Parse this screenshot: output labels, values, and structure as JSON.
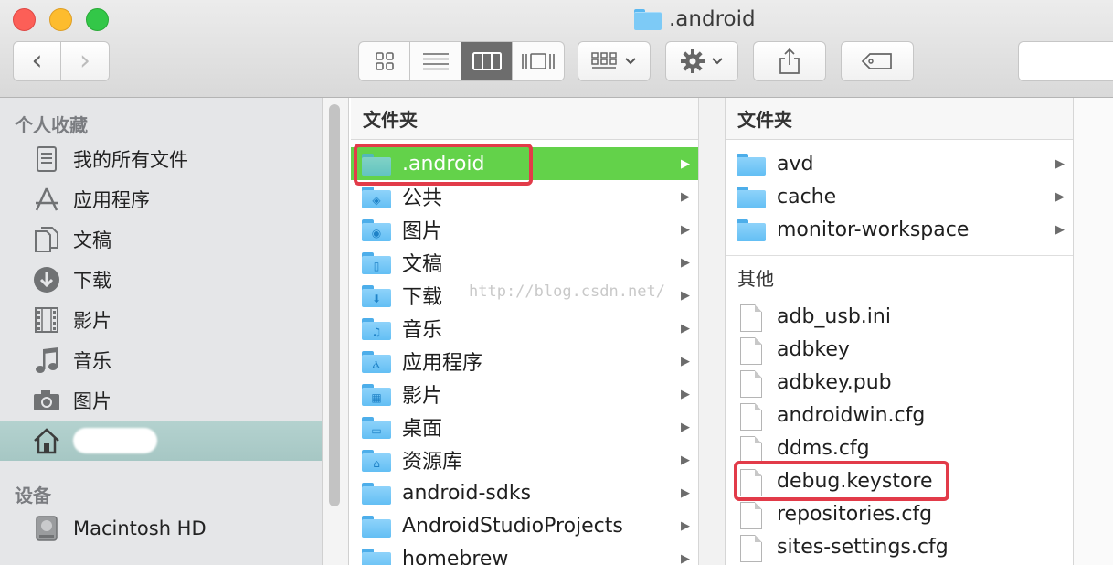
{
  "window": {
    "title": ".android"
  },
  "toolbar": {
    "back_glyph": "‹",
    "forward_glyph": "›",
    "view_modes": [
      "icon-view",
      "list-view",
      "column-view",
      "coverflow-view"
    ],
    "active_view": "column-view"
  },
  "sidebar": {
    "favorites_header": "个人收藏",
    "favorites": [
      {
        "label": "我的所有文件",
        "icon": "all-files-icon"
      },
      {
        "label": "应用程序",
        "icon": "applications-icon"
      },
      {
        "label": "文稿",
        "icon": "documents-icon"
      },
      {
        "label": "下载",
        "icon": "downloads-icon"
      },
      {
        "label": "影片",
        "icon": "movies-icon"
      },
      {
        "label": "音乐",
        "icon": "music-icon"
      },
      {
        "label": "图片",
        "icon": "pictures-icon"
      },
      {
        "label": "",
        "icon": "home-icon",
        "selected": true
      }
    ],
    "devices_header": "设备",
    "devices": [
      {
        "label": "Macintosh HD",
        "icon": "hard-drive-icon"
      }
    ]
  },
  "column1": {
    "header": "文件夹",
    "items": [
      {
        "label": ".android",
        "icon": "folder",
        "selected": true
      },
      {
        "label": "公共",
        "icon": "public-folder"
      },
      {
        "label": "图片",
        "icon": "pictures-folder"
      },
      {
        "label": "文稿",
        "icon": "documents-folder"
      },
      {
        "label": "下载",
        "icon": "downloads-folder"
      },
      {
        "label": "音乐",
        "icon": "music-folder"
      },
      {
        "label": "应用程序",
        "icon": "applications-folder"
      },
      {
        "label": "影片",
        "icon": "movies-folder"
      },
      {
        "label": "桌面",
        "icon": "desktop-folder"
      },
      {
        "label": "资源库",
        "icon": "library-folder"
      },
      {
        "label": "android-sdks",
        "icon": "folder"
      },
      {
        "label": "AndroidStudioProjects",
        "icon": "folder"
      },
      {
        "label": "homebrew",
        "icon": "folder"
      }
    ]
  },
  "column2": {
    "header": "文件夹",
    "folders": [
      {
        "label": "avd"
      },
      {
        "label": "cache"
      },
      {
        "label": "monitor-workspace"
      }
    ],
    "other_header": "其他",
    "files": [
      {
        "label": "adb_usb.ini"
      },
      {
        "label": "adbkey"
      },
      {
        "label": "adbkey.pub"
      },
      {
        "label": "androidwin.cfg"
      },
      {
        "label": "ddms.cfg"
      },
      {
        "label": "debug.keystore",
        "highlighted": true
      },
      {
        "label": "repositories.cfg"
      },
      {
        "label": "sites-settings.cfg"
      }
    ]
  },
  "watermark": "http://blog.csdn.net/",
  "colors": {
    "selection_green": "#63d24a",
    "annotation_red": "#e23b49",
    "sidebar_selected": "#a6c7c4"
  }
}
